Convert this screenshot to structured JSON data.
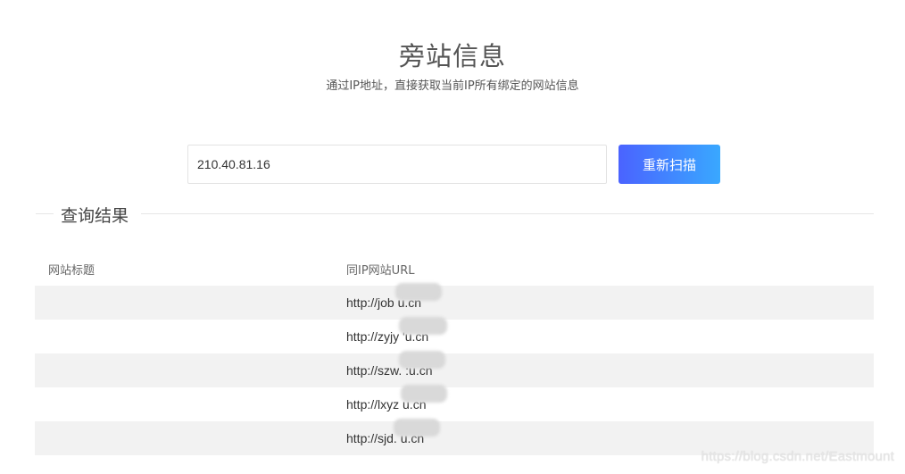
{
  "header": {
    "title": "旁站信息",
    "subtitle": "通过IP地址，直接获取当前IP所有绑定的网站信息"
  },
  "search": {
    "value": "210.40.81.16",
    "button_label": "重新扫描"
  },
  "results": {
    "heading": "查询结果",
    "columns": [
      "网站标题",
      "同IP网站URL"
    ],
    "rows": [
      {
        "title": "",
        "url": "http://job          u.cn"
      },
      {
        "title": "",
        "url": "http://zyjy          'u.cn"
      },
      {
        "title": "",
        "url": "http://szw.          :u.cn"
      },
      {
        "title": "",
        "url": "http://lxyz          u.cn"
      },
      {
        "title": "",
        "url": "http://sjd.          u.cn"
      }
    ]
  },
  "watermark": {
    "text": "https://blog.csdn.net/Eastmount"
  },
  "colors": {
    "button_gradient_start": "#4a63ff",
    "button_gradient_end": "#39a8ff",
    "stripe": "#f2f2f2"
  }
}
